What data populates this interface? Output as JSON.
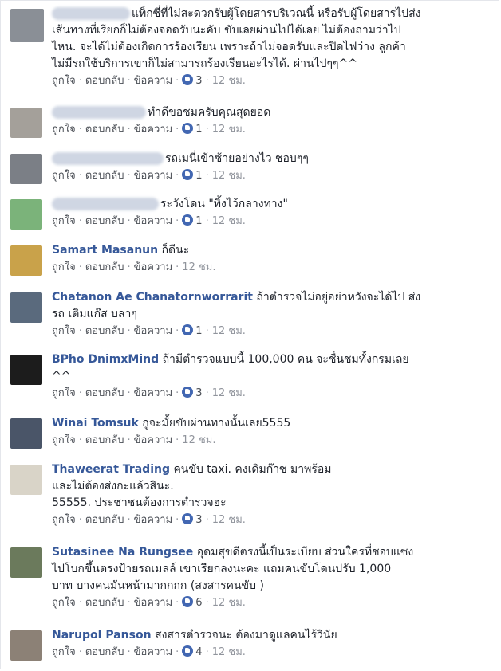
{
  "actions": {
    "like": "ถูกใจ",
    "reply": "ตอบกลับ",
    "message": "ข้อความ",
    "sep": "·"
  },
  "comments": [
    {
      "name": "",
      "text1": "แท็กซี่ที่ไม่สะดวกรับผู้โดยสารบริเวณนี้ หรือรับผู้โดยสารไปส่ง",
      "text2": "เส้นทางที่เรียกก็ไม่ต้องจอดรับนะคับ ขับเลยผ่านไปได้เลย ไม่ต้องถามว่าไป",
      "text3": "ไหน. จะได้ไม่ต้องเกิดการร้องเรียน เพราะถ้าไม่จอดรับและปิดไฟว่าง ลูกค้า",
      "text4": "ไม่มีรถใช้บริการเขาก็ไม่สามารถร้องเรียนอะไรได้. ผ่านไปๆๆ^^",
      "reactions": "3",
      "time": "12 ชม.",
      "avatar_color": "#8a8f96"
    },
    {
      "name": "",
      "text1": "ทำดีขอชมครับคุณสุดยอด",
      "reactions": "1",
      "time": "12 ชม.",
      "avatar_color": "#a4a09a"
    },
    {
      "name": "",
      "text1": "รถเมนี่เข้าซ้ายอย่างไว ชอบๆๆ",
      "reactions": "1",
      "time": "12 ชม.",
      "avatar_color": "#7b7f86"
    },
    {
      "name": "",
      "text1": "ระวังโดน \"ทิ้งไว้กลางทาง\"",
      "reactions": "1",
      "time": "12 ชม.",
      "avatar_color": "#7bb37a"
    },
    {
      "name": "Samart Masanun",
      "text1": "ก็ดีนะ",
      "reactions": "",
      "time": "12 ชม.",
      "avatar_color": "#c9a24a"
    },
    {
      "name": "Chatanon Ae Chanatornworrarit",
      "text1": "ถ้าตำรวจไม่อยู่อย่าหวังจะได้ไป ส่ง",
      "text2": "รถ เติมแก๊ส บลาๆ",
      "reactions": "1",
      "time": "12 ชม.",
      "avatar_color": "#5a6a7d"
    },
    {
      "name": "BPho DnimxMind",
      "text1": "ถ้ามีตำรวจแบบนี้ 100,000 คน จะชื่นชมทั้งกรมเลย",
      "text2": "^^",
      "reactions": "3",
      "time": "12 ชม.",
      "avatar_color": "#1c1c1c"
    },
    {
      "name": "Winai Tomsuk",
      "text1": "กูจะมั้ยขับผ่านทางนั้นเลย5555",
      "reactions": "",
      "time": "12 ชม.",
      "avatar_color": "#4a5568"
    },
    {
      "name": "Thaweerat Trading",
      "text1": "คนขับ taxi. คงเดิมก๊าซ มาพร้อม",
      "text2": "และไม่ต้องส่งกะแล้วสินะ.",
      "text3": "55555. ประชาชนต้องการตำรวจฮะ",
      "reactions": "3",
      "time": "12 ชม.",
      "avatar_color": "#d9d4c8"
    },
    {
      "name": "Sutasinee Na Rungsee",
      "text1": "อุดมสุขดีตรงนี้เป็นระเบียบ ส่วนใครที่ชอบแซง",
      "text2": "ไปโบกขึ้นตรงป้ายรถเมลล์ เขาเรียกลงนะคะ แถมคนขับโดนปรับ 1,000",
      "text3": "บาท บางคนมันหน้ามากกกก (สงสารคนขับ )",
      "reactions": "6",
      "time": "12 ชม.",
      "avatar_color": "#6b7a5c"
    },
    {
      "name": "Narupol Panson",
      "text1": "สงสารตำรวจนะ ต้องมาดูแลคนไร้วินัย",
      "reactions": "4",
      "time": "12 ชม.",
      "avatar_color": "#8c8176"
    }
  ]
}
